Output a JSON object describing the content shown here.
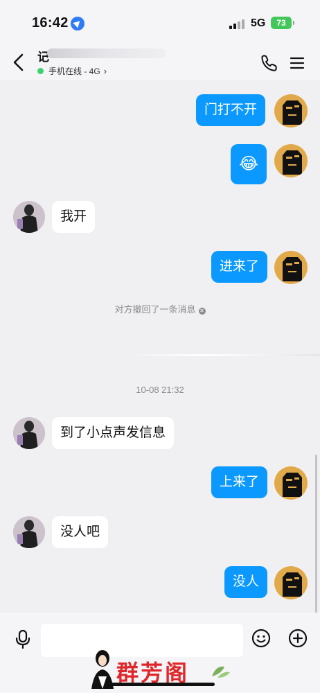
{
  "status_bar": {
    "time": "16:42",
    "network": "5G",
    "battery": "73"
  },
  "header": {
    "title_visible_char": "记",
    "status": "手机在线 - 4G"
  },
  "messages": [
    {
      "side": "right",
      "text": "门打不开"
    },
    {
      "side": "right",
      "text": "😂"
    },
    {
      "side": "left",
      "text": "我开"
    },
    {
      "side": "right",
      "text": "进来了"
    },
    {
      "side": "left",
      "text": "到了小点声发信息"
    },
    {
      "side": "right",
      "text": "上来了"
    },
    {
      "side": "left",
      "text": "没人吧"
    },
    {
      "side": "right",
      "text": "没人"
    }
  ],
  "system": {
    "recall_notice": "对方撤回了一条消息",
    "timestamp": "10-08 21:32"
  },
  "input": {
    "placeholder": ""
  },
  "watermark": {
    "text": "群芳阁"
  },
  "colors": {
    "bubble_out": "#0b99ff",
    "bubble_in": "#ffffff",
    "online": "#3cd26d",
    "battery": "#43c75a"
  }
}
